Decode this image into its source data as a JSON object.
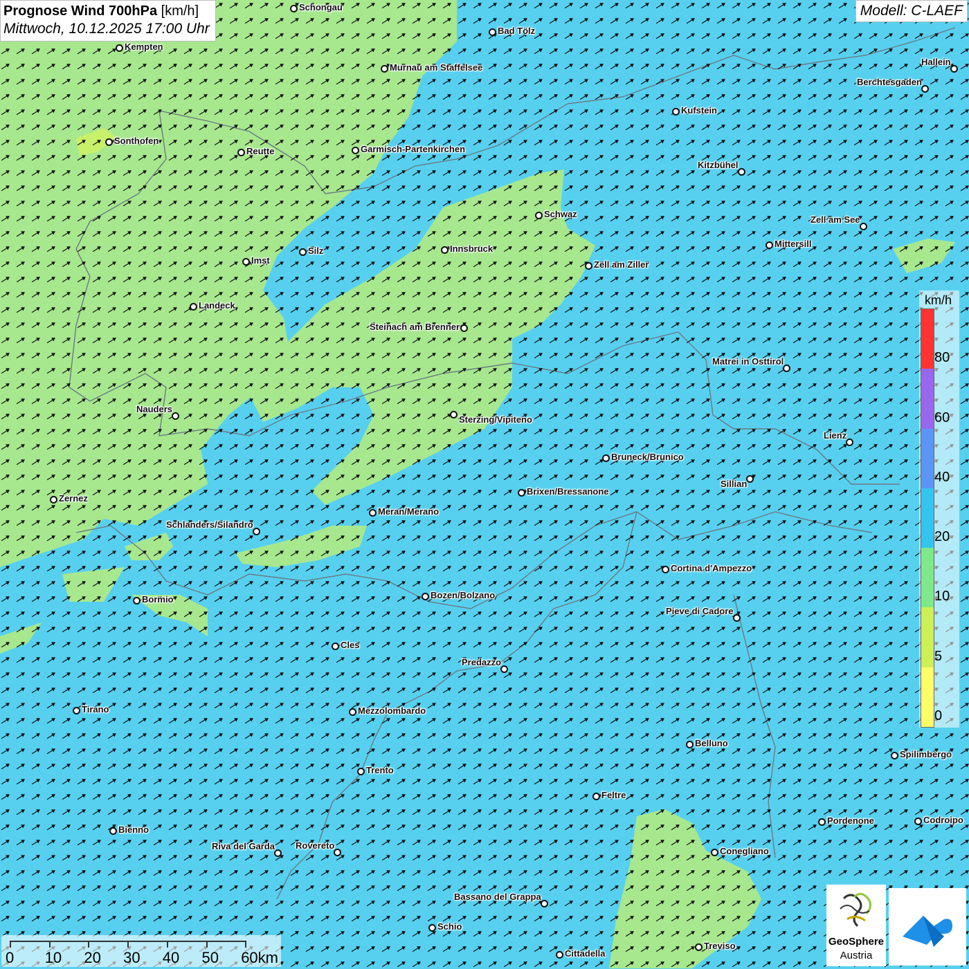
{
  "header": {
    "title": "Prognose Wind 700hPa",
    "unit": "[km/h]",
    "datetime": "Mittwoch, 10.12.2025 17:00 Uhr",
    "model": "Modell: C-LAEF"
  },
  "cities": [
    {
      "name": "Schongau",
      "label": "Schongau"
    },
    {
      "name": "Bad Tölz",
      "label": "Bad Tölz"
    },
    {
      "name": "Kempten",
      "label": "Kempten"
    },
    {
      "name": "Murnau",
      "label": "Murnau am Staffelsee"
    },
    {
      "name": "Hallein",
      "label": "Hallein"
    },
    {
      "name": "Berchtesgaden",
      "label": "Berchtesgaden"
    },
    {
      "name": "Kufstein",
      "label": "Kufstein"
    },
    {
      "name": "Sonthofen",
      "label": "Sonthofen"
    },
    {
      "name": "Reutte",
      "label": "Reutte"
    },
    {
      "name": "Garmisch",
      "label": "Garmisch-Partenkirchen"
    },
    {
      "name": "Kitzbühel",
      "label": "Kitzbühel"
    },
    {
      "name": "Schwaz",
      "label": "Schwaz"
    },
    {
      "name": "Zell am See",
      "label": "Zell am See"
    },
    {
      "name": "Mittersill",
      "label": "Mittersill"
    },
    {
      "name": "Silz",
      "label": "Silz"
    },
    {
      "name": "Innsbruck",
      "label": "Innsbruck"
    },
    {
      "name": "Imst",
      "label": "Imst"
    },
    {
      "name": "Zell am Ziller",
      "label": "Zell am Ziller"
    },
    {
      "name": "Landeck",
      "label": "Landeck"
    },
    {
      "name": "Steinach",
      "label": "Steinach am Brenner"
    },
    {
      "name": "Matrei",
      "label": "Matrei in Osttirol"
    },
    {
      "name": "Nauders",
      "label": "Nauders"
    },
    {
      "name": "Sterzing",
      "label": "Sterzing/Vipiteno"
    },
    {
      "name": "Lienz",
      "label": "Lienz"
    },
    {
      "name": "Bruneck",
      "label": "Bruneck/Brunico"
    },
    {
      "name": "Sillian",
      "label": "Sillian"
    },
    {
      "name": "Brixen",
      "label": "Brixen/Bressanone"
    },
    {
      "name": "Zernez",
      "label": "Zernez"
    },
    {
      "name": "Meran",
      "label": "Meran/Merano"
    },
    {
      "name": "Schlanders",
      "label": "Schlanders/Silandro"
    },
    {
      "name": "Cortina",
      "label": "Cortina d'Ampezzo"
    },
    {
      "name": "Bozen",
      "label": "Bozen/Bolzano"
    },
    {
      "name": "Bormio",
      "label": "Bormio"
    },
    {
      "name": "Pieve di Cadore",
      "label": "Pieve di Cadore"
    },
    {
      "name": "Cles",
      "label": "Cles"
    },
    {
      "name": "Predazzo",
      "label": "Predazzo"
    },
    {
      "name": "Tirano",
      "label": "Tirano"
    },
    {
      "name": "Mezzolombardo",
      "label": "Mezzolombardo"
    },
    {
      "name": "Belluno",
      "label": "Belluno"
    },
    {
      "name": "Spilimbergo",
      "label": "Spilimbergo"
    },
    {
      "name": "Trento",
      "label": "Trento"
    },
    {
      "name": "Feltre",
      "label": "Feltre"
    },
    {
      "name": "Bienno",
      "label": "Bienno"
    },
    {
      "name": "Pordenone",
      "label": "Pordenone"
    },
    {
      "name": "Codroipo",
      "label": "Codroipo"
    },
    {
      "name": "Riva del Garda",
      "label": "Riva del Garda"
    },
    {
      "name": "Rovereto",
      "label": "Rovereto"
    },
    {
      "name": "Conegliano",
      "label": "Conegliano"
    },
    {
      "name": "Bassano",
      "label": "Bassano del Grappa"
    },
    {
      "name": "Schio",
      "label": "Schio"
    },
    {
      "name": "Treviso",
      "label": "Treviso"
    },
    {
      "name": "Cittadella",
      "label": "Cittadella"
    }
  ],
  "legend": {
    "unit": "km/h",
    "bins": [
      {
        "label": "80",
        "color": "#ff3333"
      },
      {
        "label": "60",
        "color": "#9966ee"
      },
      {
        "label": "40",
        "color": "#5b95f5"
      },
      {
        "label": "20",
        "color": "#33c4f0"
      },
      {
        "label": "10",
        "color": "#7fe88a"
      },
      {
        "label": "5",
        "color": "#ccf055"
      },
      {
        "label": "0",
        "color": "#ffff66"
      }
    ]
  },
  "field_colors": {
    "low": "#a7e88e",
    "mid": "#57d0f0",
    "wind_arrow": "#111111"
  },
  "wind": {
    "direction": "SW to NE"
  },
  "scale_bar": {
    "labels": [
      "0",
      "10",
      "20",
      "30",
      "40",
      "50",
      "60km"
    ]
  },
  "logos": {
    "geosphere_line1": "GeoSphere",
    "geosphere_line2": "Austria"
  },
  "icons": [
    "geosphere-logo-icon",
    "cloud-app-icon"
  ]
}
